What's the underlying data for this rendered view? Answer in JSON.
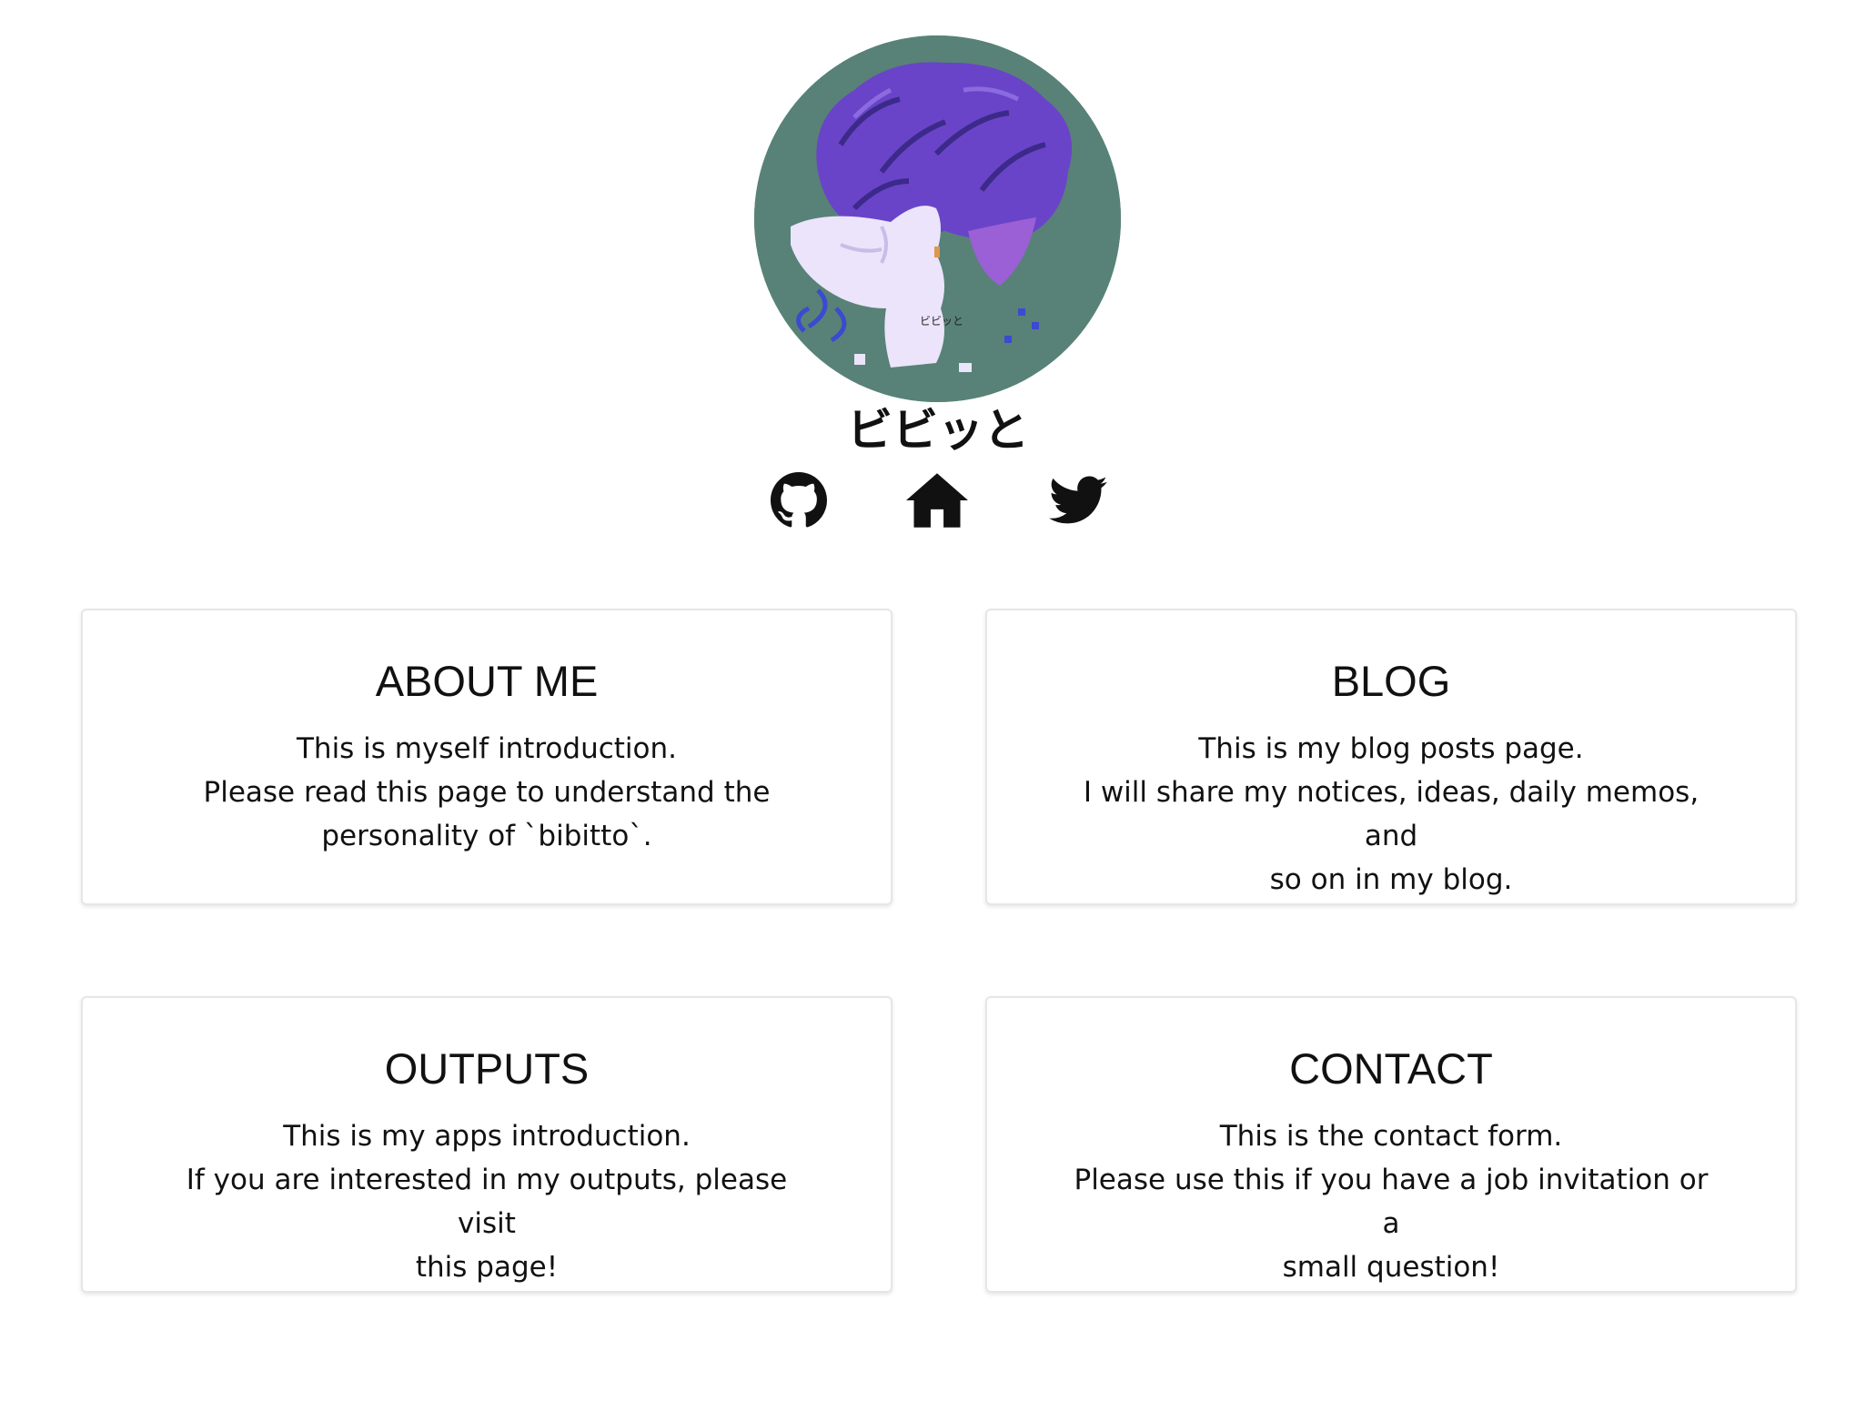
{
  "profile": {
    "name": "ビビッと",
    "avatar_text": "ビビッと",
    "colors": {
      "avatar_background": "#588277",
      "hair": "#6a44c8",
      "figure": "#ece4fb"
    }
  },
  "social_links": [
    {
      "name": "github",
      "icon": "github-icon"
    },
    {
      "name": "home",
      "icon": "home-icon"
    },
    {
      "name": "twitter",
      "icon": "twitter-icon"
    }
  ],
  "cards": [
    {
      "title": "ABOUT ME",
      "lines": [
        "This is myself introduction.",
        "Please read this page to understand the",
        "personality of `bibitto`."
      ]
    },
    {
      "title": "BLOG",
      "lines": [
        "This is my blog posts page.",
        "I will share my notices, ideas, daily memos, and",
        "so on in my blog."
      ]
    },
    {
      "title": "OUTPUTS",
      "lines": [
        "This is my apps introduction.",
        "If you are interested in my outputs, please visit",
        "this page!"
      ]
    },
    {
      "title": "CONTACT",
      "lines": [
        "This is the contact form.",
        "Please use this if you have a job invitation or a",
        "small question!"
      ]
    }
  ]
}
